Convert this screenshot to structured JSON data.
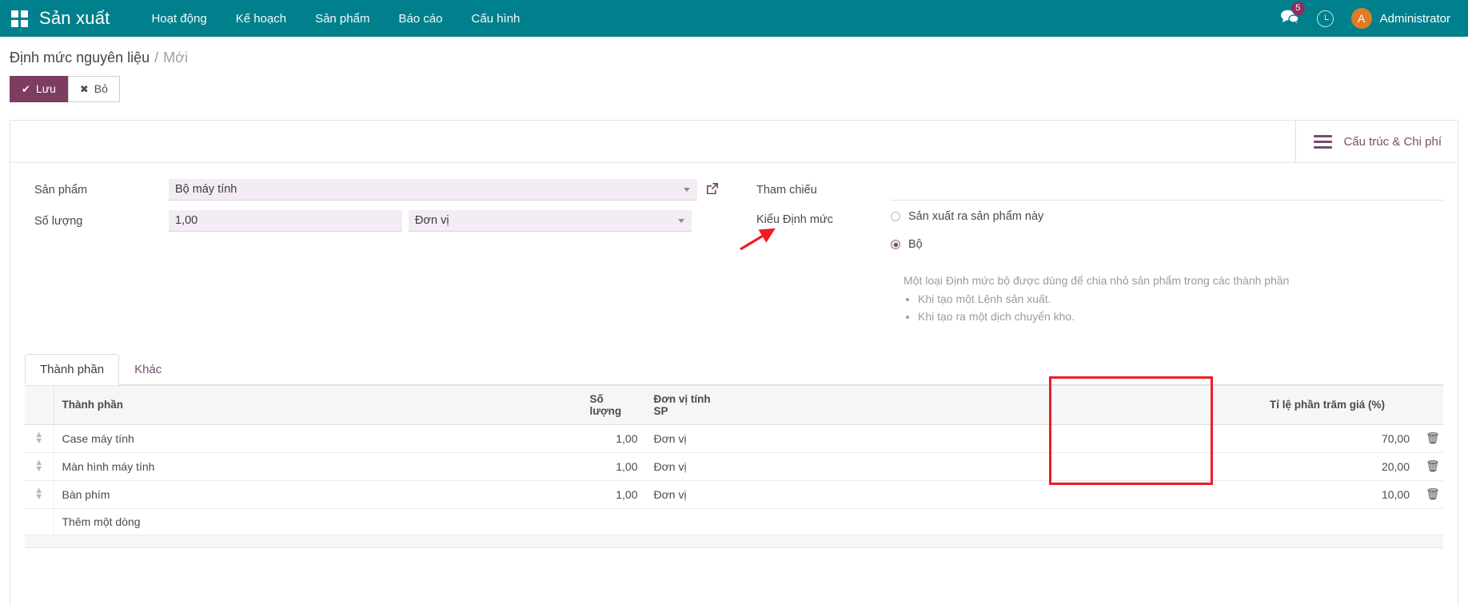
{
  "navbar": {
    "apps_icon": "apps-grid-icon",
    "brand": "Sản xuất",
    "menu": [
      {
        "label": "Hoạt động"
      },
      {
        "label": "Kế hoạch"
      },
      {
        "label": "Sản phẩm"
      },
      {
        "label": "Báo cáo"
      },
      {
        "label": "Cấu hình"
      }
    ],
    "messages_icon": "chat-bubble-icon",
    "messages_count": "5",
    "activity_icon": "clock-icon",
    "avatar_initial": "A",
    "user_name": "Administrator"
  },
  "breadcrumb": {
    "root": "Định mức nguyên liệu",
    "separator": "/",
    "current": "Mới"
  },
  "actions": {
    "save_icon": "check-icon",
    "save_label": "Lưu",
    "discard_icon": "times-icon",
    "discard_label": "Bỏ"
  },
  "stat_buttons": [
    {
      "icon": "list-hamburger-icon",
      "label": "Cấu trúc & Chi phí"
    }
  ],
  "form": {
    "product": {
      "label": "Sản phẩm",
      "value": "Bộ máy tính",
      "dropdown_icon": "chevron-down-icon",
      "external_link_icon": "external-link-icon"
    },
    "quantity": {
      "label": "Số lượng",
      "value": "1,00",
      "uom_value": "Đơn vị",
      "dropdown_icon": "chevron-down-icon"
    },
    "reference": {
      "label": "Tham chiếu",
      "value": "",
      "placeholder": ""
    },
    "bom_type": {
      "label": "Kiểu Định mức",
      "options": [
        {
          "label": "Sản xuất ra sản phẩm này",
          "selected": false
        },
        {
          "label": "Bộ",
          "selected": true
        }
      ],
      "help_text": "Một loại Định mức bộ được dùng để chia nhỏ sản phẩm trong các thành phần",
      "help_items": [
        "Khi tạo một Lệnh sản xuất.",
        "Khi tạo ra một dịch chuyển kho."
      ]
    }
  },
  "tabs": [
    {
      "label": "Thành phần",
      "active": true
    },
    {
      "label": "Khác",
      "active": false
    }
  ],
  "components_table": {
    "columns": {
      "handle": "",
      "name": "Thành phần",
      "quantity": "Số lượng",
      "uom": "Đơn vị tính SP",
      "mid": "",
      "percentage": "Tỉ lệ phần trăm giá (%)",
      "delete": ""
    },
    "rows": [
      {
        "handle_icon": "drag-handle-icon",
        "name": "Case máy tính",
        "quantity": "1,00",
        "uom": "Đơn vị",
        "percentage": "70,00",
        "delete_icon": "trash-icon"
      },
      {
        "handle_icon": "drag-handle-icon",
        "name": "Màn hình máy tính",
        "quantity": "1,00",
        "uom": "Đơn vị",
        "percentage": "20,00",
        "delete_icon": "trash-icon"
      },
      {
        "handle_icon": "drag-handle-icon",
        "name": "Bàn phím",
        "quantity": "1,00",
        "uom": "Đơn vị",
        "percentage": "10,00",
        "delete_icon": "trash-icon"
      }
    ],
    "add_line_label": "Thêm một dòng"
  },
  "annotations": {
    "arrow_color": "#ee1c25",
    "highlight_color": "#ee1c25",
    "arrow_target": "Bộ",
    "highlight_target": "Tỉ lệ phần trăm giá (%)"
  },
  "colors": {
    "navbar": "#00808c",
    "primary": "#7d3d62",
    "accent_link": "#7d4b6d",
    "field_bg": "#f4ecf4",
    "badge": "#8f2e63",
    "avatar": "#e07b26"
  }
}
